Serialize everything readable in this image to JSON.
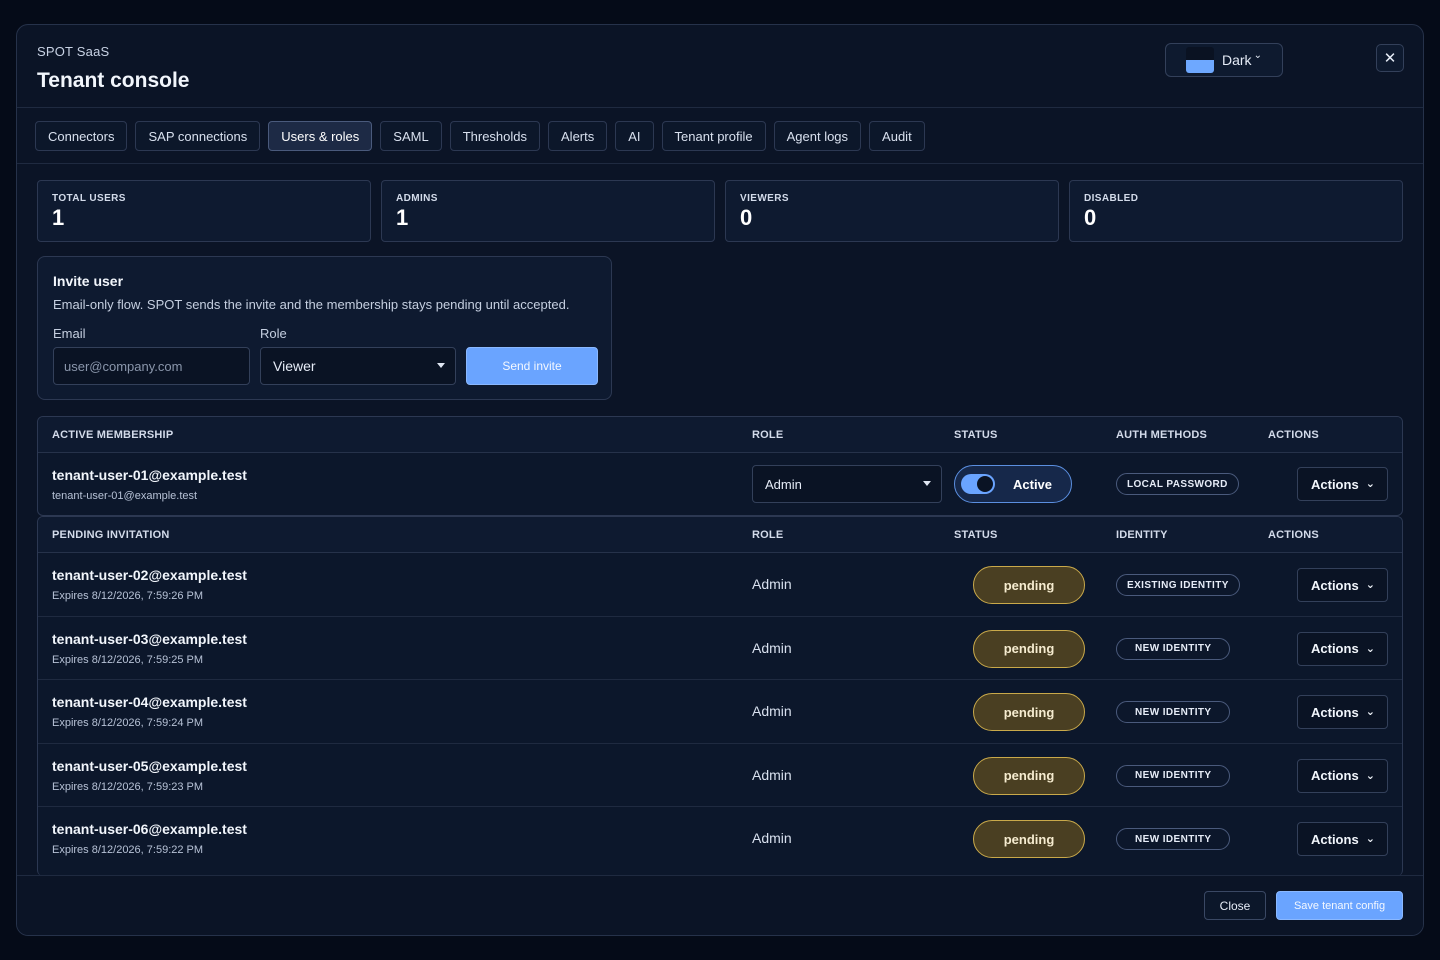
{
  "header": {
    "brand": "SPOT SaaS",
    "title": "Tenant console",
    "theme_label": "Dark",
    "close_symbol": "✕"
  },
  "tabs": [
    {
      "label": "Connectors"
    },
    {
      "label": "SAP connections"
    },
    {
      "label": "Users & roles",
      "active": true
    },
    {
      "label": "SAML"
    },
    {
      "label": "Thresholds"
    },
    {
      "label": "Alerts"
    },
    {
      "label": "AI"
    },
    {
      "label": "Tenant profile"
    },
    {
      "label": "Agent logs"
    },
    {
      "label": "Audit"
    }
  ],
  "stats": [
    {
      "label": "TOTAL USERS",
      "value": "1"
    },
    {
      "label": "ADMINS",
      "value": "1"
    },
    {
      "label": "VIEWERS",
      "value": "0"
    },
    {
      "label": "DISABLED",
      "value": "0"
    }
  ],
  "invite": {
    "title": "Invite user",
    "description": "Email-only flow. SPOT sends the invite and the membership stays pending until accepted.",
    "email_label": "Email",
    "email_placeholder": "user@company.com",
    "role_label": "Role",
    "role_value": "Viewer",
    "send_label": "Send invite"
  },
  "active": {
    "headers": {
      "membership": "ACTIVE MEMBERSHIP",
      "role": "ROLE",
      "status": "STATUS",
      "auth": "AUTH METHODS",
      "actions": "ACTIONS"
    },
    "row": {
      "email": "tenant-user-01@example.test",
      "sub": "tenant-user-01@example.test",
      "role": "Admin",
      "status": "Active",
      "auth": "LOCAL PASSWORD",
      "actions": "Actions"
    }
  },
  "pending": {
    "headers": {
      "invitation": "PENDING INVITATION",
      "role": "ROLE",
      "status": "STATUS",
      "identity": "IDENTITY",
      "actions": "ACTIONS"
    },
    "rows": [
      {
        "email": "tenant-user-02@example.test",
        "expires": "Expires 8/12/2026, 7:59:26 PM",
        "role": "Admin",
        "status": "pending",
        "identity": "EXISTING IDENTITY",
        "actions": "Actions"
      },
      {
        "email": "tenant-user-03@example.test",
        "expires": "Expires 8/12/2026, 7:59:25 PM",
        "role": "Admin",
        "status": "pending",
        "identity": "NEW IDENTITY",
        "actions": "Actions"
      },
      {
        "email": "tenant-user-04@example.test",
        "expires": "Expires 8/12/2026, 7:59:24 PM",
        "role": "Admin",
        "status": "pending",
        "identity": "NEW IDENTITY",
        "actions": "Actions"
      },
      {
        "email": "tenant-user-05@example.test",
        "expires": "Expires 8/12/2026, 7:59:23 PM",
        "role": "Admin",
        "status": "pending",
        "identity": "NEW IDENTITY",
        "actions": "Actions"
      },
      {
        "email": "tenant-user-06@example.test",
        "expires": "Expires 8/12/2026, 7:59:22 PM",
        "role": "Admin",
        "status": "pending",
        "identity": "NEW IDENTITY",
        "actions": "Actions"
      }
    ]
  },
  "footer": {
    "close_label": "Close",
    "save_label": "Save tenant config"
  },
  "colors": {
    "background": "#050b18",
    "panel": "#0b1426",
    "accent": "#6aa4ff",
    "pending_fill": "#4a3f22",
    "pending_border": "#c9a94a"
  }
}
